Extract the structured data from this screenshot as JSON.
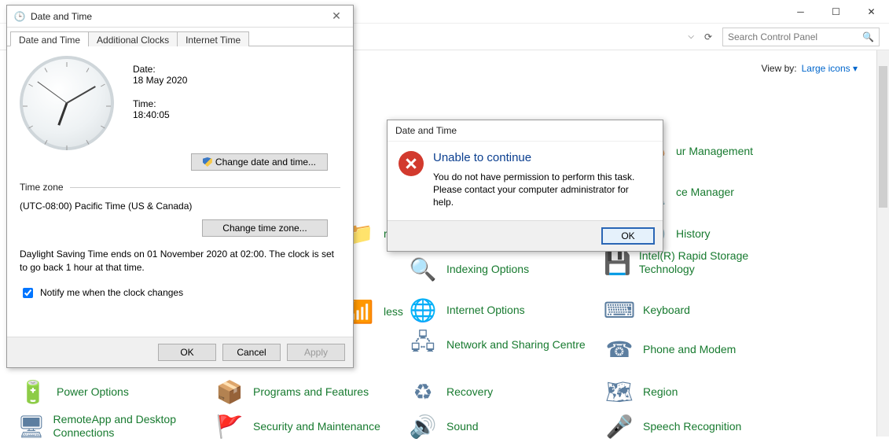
{
  "cpanel": {
    "search_placeholder": "Search Control Panel",
    "view_by_label": "View by:",
    "view_by_value": "Large icons",
    "items": [
      {
        "label": "ur Management",
        "icon": "🎨"
      },
      {
        "label": "ce Manager",
        "icon": "💻"
      },
      {
        "label": "re",
        "icon": "📁"
      },
      {
        "label": "History",
        "icon": "🕑"
      },
      {
        "label": "Indexing Options",
        "icon": "🔍"
      },
      {
        "label": "Intel(R) Rapid Storage Technology",
        "icon": "💾"
      },
      {
        "label": "less",
        "icon": "📶"
      },
      {
        "label": "Internet Options",
        "icon": "🌐"
      },
      {
        "label": "Keyboard",
        "icon": "⌨"
      },
      {
        "label": "Network and Sharing Centre",
        "icon": "🖧"
      },
      {
        "label": "Phone and Modem",
        "icon": "☎"
      },
      {
        "label": "Power Options",
        "icon": "🔋"
      },
      {
        "label": "Programs and Features",
        "icon": "📦"
      },
      {
        "label": "Recovery",
        "icon": "♻"
      },
      {
        "label": "Region",
        "icon": "🗺"
      },
      {
        "label": "RemoteApp and Desktop Connections",
        "icon": "🖥"
      },
      {
        "label": "Security and Maintenance",
        "icon": "🚩"
      },
      {
        "label": "Sound",
        "icon": "🔊"
      },
      {
        "label": "Speech Recognition",
        "icon": "🎤"
      }
    ]
  },
  "dt": {
    "title": "Date and Time",
    "tabs": [
      "Date and Time",
      "Additional Clocks",
      "Internet Time"
    ],
    "date_label": "Date:",
    "date_value": "18 May 2020",
    "time_label": "Time:",
    "time_value": "18:40:05",
    "change_dt_btn": "Change date and time...",
    "tz_label": "Time zone",
    "tz_value": "(UTC-08:00) Pacific Time (US & Canada)",
    "change_tz_btn": "Change time zone...",
    "dst_text": "Daylight Saving Time ends on 01 November 2020 at 02:00. The clock is set to go back 1 hour at that time.",
    "notify_label": "Notify me when the clock changes",
    "notify_checked": true,
    "btn_ok": "OK",
    "btn_cancel": "Cancel",
    "btn_apply": "Apply"
  },
  "err": {
    "title": "Date and Time",
    "heading": "Unable to continue",
    "line1": "You do not have permission to perform this task.",
    "line2": "Please contact your computer administrator for help.",
    "btn_ok": "OK"
  }
}
